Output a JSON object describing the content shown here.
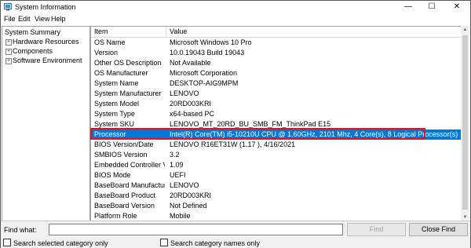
{
  "window": {
    "title": "System Information",
    "controls": {
      "minimize": "—",
      "maximize": "☐",
      "close": "✕"
    }
  },
  "menu": [
    "File",
    "Edit",
    "View",
    "Help"
  ],
  "tree": {
    "root": "System Summary",
    "children": [
      "Hardware Resources",
      "Components",
      "Software Environment"
    ]
  },
  "table": {
    "headers": {
      "item": "Item",
      "value": "Value"
    },
    "selected_item": "Processor",
    "rows": [
      {
        "item": "OS Name",
        "value": "Microsoft Windows 10 Pro"
      },
      {
        "item": "Version",
        "value": "10.0.19043 Build 19043"
      },
      {
        "item": "Other OS Description",
        "value": "Not Available"
      },
      {
        "item": "OS Manufacturer",
        "value": "Microsoft Corporation"
      },
      {
        "item": "System Name",
        "value": "DESKTOP-AIG9MPM"
      },
      {
        "item": "System Manufacturer",
        "value": "LENOVO"
      },
      {
        "item": "System Model",
        "value": "20RD003KRI"
      },
      {
        "item": "System Type",
        "value": "x64-based PC"
      },
      {
        "item": "System SKU",
        "value": "LENOVO_MT_20RD_BU_SMB_FM_ThinkPad E15"
      },
      {
        "item": "Processor",
        "value": "Intel(R) Core(TM) i5-10210U CPU @ 1.60GHz, 2101 Mhz, 4 Core(s), 8 Logical Processor(s)"
      },
      {
        "item": "BIOS Version/Date",
        "value": "LENOVO R16ET31W (1.17 ), 4/16/2021"
      },
      {
        "item": "SMBIOS Version",
        "value": "3.2"
      },
      {
        "item": "Embedded Controller V...",
        "value": "1.09"
      },
      {
        "item": "BIOS Mode",
        "value": "UEFI"
      },
      {
        "item": "BaseBoard Manufacturer",
        "value": "LENOVO"
      },
      {
        "item": "BaseBoard Product",
        "value": "20RD003KRI"
      },
      {
        "item": "BaseBoard Version",
        "value": "Not Defined"
      },
      {
        "item": "Platform Role",
        "value": "Mobile"
      }
    ]
  },
  "find": {
    "label": "Find what:",
    "value": "",
    "find_button": "Find",
    "close_button": "Close Find",
    "search_selected": "Search selected category only",
    "search_names": "Search category names only"
  },
  "colors": {
    "selection": "#0078d7",
    "highlight_box": "#e81123"
  }
}
